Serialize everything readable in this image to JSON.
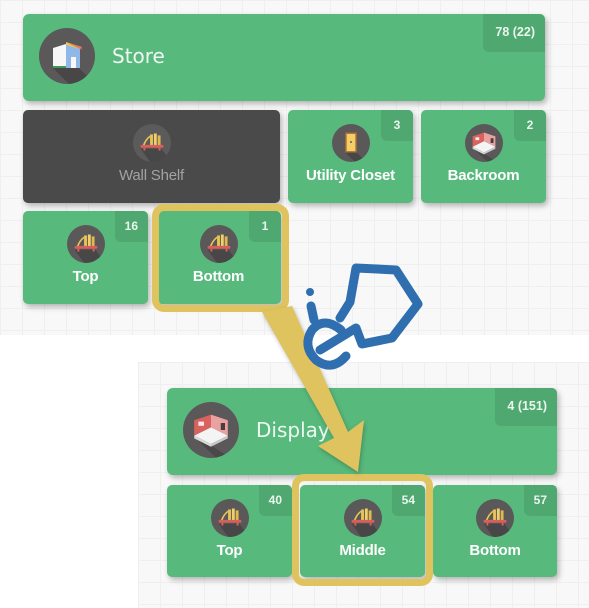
{
  "top_section": {
    "header": {
      "label": "Store",
      "badge": "78 (22)",
      "icon": "store-building-icon"
    },
    "tiles": [
      {
        "label": "Wall Shelf",
        "badge": "",
        "icon": "shelf-icon",
        "state": "selected-dark"
      },
      {
        "label": "Utility Closet",
        "badge": "3",
        "icon": "door-icon"
      },
      {
        "label": "Backroom",
        "badge": "2",
        "icon": "room-icon"
      }
    ],
    "sub_tiles": [
      {
        "label": "Top",
        "badge": "16",
        "icon": "shelf-icon"
      },
      {
        "label": "Bottom",
        "badge": "1",
        "icon": "shelf-icon",
        "highlighted": true
      }
    ]
  },
  "bottom_section": {
    "header": {
      "label": "Display",
      "badge": "4 (151)",
      "icon": "room-icon"
    },
    "tiles": [
      {
        "label": "Top",
        "badge": "40",
        "icon": "shelf-icon"
      },
      {
        "label": "Middle",
        "badge": "54",
        "icon": "shelf-icon",
        "highlighted": true
      },
      {
        "label": "Bottom",
        "badge": "57",
        "icon": "shelf-icon"
      }
    ]
  },
  "annotations": {
    "arrow_icon": "down-arrow-icon",
    "gesture_icon": "drag-hand-icon",
    "highlight_color": "#dfc35f",
    "accent_color": "#58b97c",
    "gesture_color": "#2f6fb0"
  }
}
